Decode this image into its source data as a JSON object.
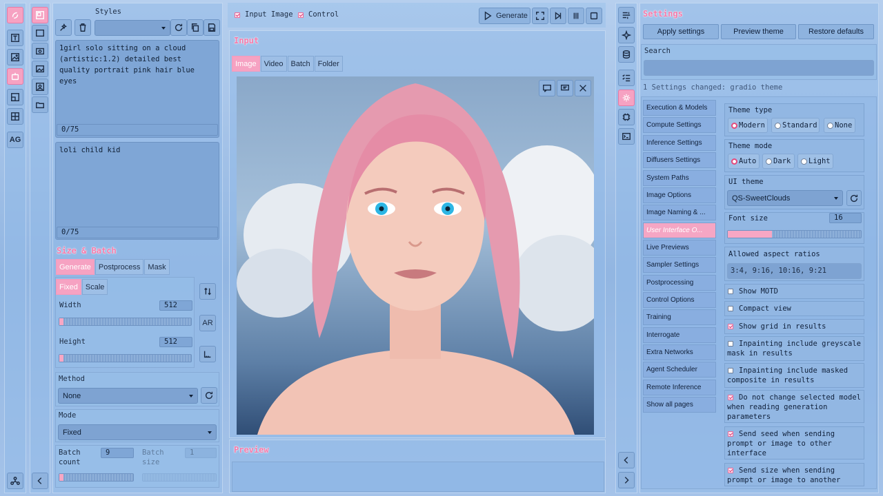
{
  "left_rail": {
    "icons": [
      "logo-icon",
      "text-icon",
      "image-icon",
      "robot-icon",
      "control-icon",
      "layout-icon"
    ],
    "ag_label": "AG",
    "bottom_icon": "network-icon"
  },
  "networks_rail": {
    "icons": [
      "network-pages-icon",
      "extra-networks-icon",
      "camera-icon",
      "gallery-icon",
      "user-icon",
      "folder-icon"
    ]
  },
  "styles": {
    "label": "Styles",
    "selected": ""
  },
  "prompt": {
    "text": "1girl solo sitting on a cloud (artistic:1.2) detailed best quality portrait pink hair blue eyes",
    "token_count": "0/75"
  },
  "negative": {
    "text": "loli child kid",
    "token_count": "0/75"
  },
  "size_batch": {
    "title": "Size & Batch",
    "tabs": [
      "Generate",
      "Postprocess",
      "Mask"
    ],
    "mode_tabs": [
      "Fixed",
      "Scale"
    ],
    "width": {
      "label": "Width",
      "value": "512",
      "fraction": 0.03
    },
    "height": {
      "label": "Height",
      "value": "512",
      "fraction": 0.03
    },
    "ar_label": "AR",
    "method": {
      "label": "Method",
      "value": "None"
    },
    "mode": {
      "label": "Mode",
      "value": "Fixed"
    },
    "batch_count": {
      "label": "Batch count",
      "value": "9",
      "fraction": 0.06
    },
    "batch_size": {
      "label": "Batch size",
      "value": "1"
    }
  },
  "toolbar": {
    "input_image_label": "Input Image",
    "control_label": "Control",
    "input_image_checked": true,
    "control_checked": true,
    "generate_label": "Generate"
  },
  "input": {
    "title": "Input",
    "tabs": [
      "Image",
      "Video",
      "Batch",
      "Folder"
    ]
  },
  "preview": {
    "title": "Preview"
  },
  "settings": {
    "title": "Settings",
    "apply_label": "Apply settings",
    "preview_theme_label": "Preview theme",
    "restore_label": "Restore defaults",
    "search_label": "Search",
    "search_value": "",
    "status": "1 Settings changed: gradio theme",
    "nav": [
      "Execution & Models",
      "Compute Settings",
      "Inference Settings",
      "Diffusers Settings",
      "System Paths",
      "Image Options",
      "Image Naming & ...",
      "User Interface O...",
      "Live Previews",
      "Sampler Settings",
      "Postprocessing",
      "Control Options",
      "Training",
      "Interrogate",
      "Extra Networks",
      "Agent Scheduler",
      "Remote Inference",
      "Show all pages"
    ],
    "nav_selected_index": 7,
    "theme_type": {
      "label": "Theme type",
      "options": [
        "Modern",
        "Standard",
        "None"
      ],
      "selected": "Modern"
    },
    "theme_mode": {
      "label": "Theme mode",
      "options": [
        "Auto",
        "Dark",
        "Light"
      ],
      "selected": "Auto"
    },
    "ui_theme": {
      "label": "UI theme",
      "value": "QS-SweetClouds"
    },
    "font_size": {
      "label": "Font size",
      "value": "16",
      "fraction": 0.33
    },
    "aspect": {
      "label": "Allowed aspect ratios",
      "value": "3:4, 9:16, 10:16, 9:21"
    },
    "checkboxes": [
      {
        "label": "Show MOTD",
        "checked": false
      },
      {
        "label": "Compact view",
        "checked": false
      },
      {
        "label": "Show grid in results",
        "checked": true
      },
      {
        "label": "Inpainting include greyscale mask in results",
        "checked": false
      },
      {
        "label": "Inpainting include masked composite in results",
        "checked": false
      },
      {
        "label": "Do not change selected model when reading generation parameters",
        "checked": true
      },
      {
        "label": "Send seed when sending prompt or image to other interface",
        "checked": true
      },
      {
        "label": "Send size when sending prompt or image to another",
        "checked": true
      }
    ]
  },
  "settings_rail": {
    "icons": [
      "settings-list-icon",
      "sparkle-icon",
      "database-icon",
      "checklist-icon",
      "gear-icon",
      "chip-icon",
      "terminal-icon"
    ]
  },
  "colors": {
    "accent_pink": "#f6a2c2",
    "panel_blue": "#92b9e8"
  }
}
